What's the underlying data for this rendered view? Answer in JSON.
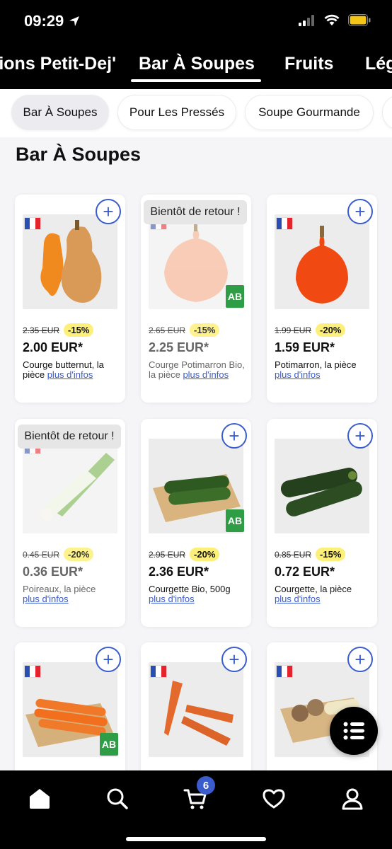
{
  "status_bar": {
    "time": "09:29"
  },
  "category_tabs": [
    {
      "label": "tions Petit-Dej'"
    },
    {
      "label": "Bar À Soupes",
      "selected": true
    },
    {
      "label": "Fruits"
    },
    {
      "label": "Lég"
    }
  ],
  "sub_chips": [
    {
      "label": "Bar À Soupes",
      "selected": true
    },
    {
      "label": "Pour Les Pressés"
    },
    {
      "label": "Soupe Gourmande"
    }
  ],
  "section_title": "Bar À Soupes",
  "products": [
    {
      "name": "Courge butternut, la pièce",
      "old_price": "2.35 EUR",
      "discount": "-15%",
      "price": "2.00 EUR*",
      "more": "plus d'infos",
      "organic": false,
      "soon": ""
    },
    {
      "name": "Courge Potimarron Bio, la pièce",
      "old_price": "2.65 EUR",
      "discount": "-15%",
      "price": "2.25 EUR*",
      "more": "plus d'infos",
      "organic": true,
      "soon": "Bientôt de retour !"
    },
    {
      "name": "Potimarron, la pièce",
      "old_price": "1.99 EUR",
      "discount": "-20%",
      "price": "1.59 EUR*",
      "more": "plus d'infos",
      "organic": false,
      "soon": ""
    },
    {
      "name": "Poireaux, la pièce",
      "old_price": "0.45 EUR",
      "discount": "-20%",
      "price": "0.36 EUR*",
      "more": "plus d'infos",
      "organic": false,
      "soon": "Bientôt de retour !"
    },
    {
      "name": "Courgette Bio, 500g",
      "old_price": "2.95 EUR",
      "discount": "-20%",
      "price": "2.36 EUR*",
      "more": "plus d'infos",
      "organic": true,
      "soon": ""
    },
    {
      "name": "Courgette, la pièce",
      "old_price": "0.85 EUR",
      "discount": "-15%",
      "price": "0.72 EUR*",
      "more": "plus d'infos",
      "organic": false,
      "soon": ""
    },
    {
      "name": "",
      "old_price": "",
      "discount": "",
      "price": "",
      "more": "",
      "organic": true,
      "soon": ""
    },
    {
      "name": "",
      "old_price": "",
      "discount": "",
      "price": "",
      "more": "",
      "organic": false,
      "soon": ""
    },
    {
      "name": "",
      "old_price": "",
      "discount": "",
      "price": "",
      "more": "",
      "organic": false,
      "soon": ""
    }
  ],
  "organic_badge": "AB",
  "cart_count": "6",
  "colors": {
    "accent": "#3a5ccc",
    "discount_bg": "#fdf07a",
    "organic": "#2e9d46"
  }
}
